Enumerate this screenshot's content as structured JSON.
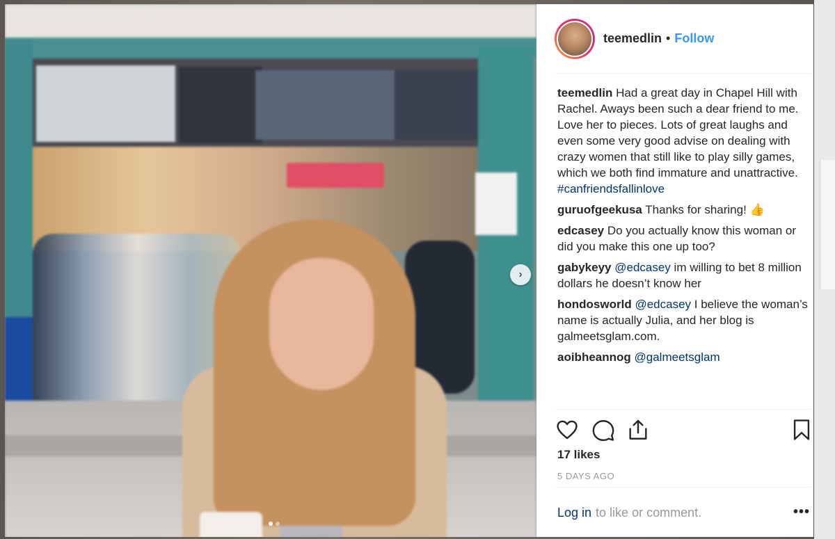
{
  "post": {
    "username": "teemedlin",
    "separator": "•",
    "follow_label": "Follow",
    "caption": {
      "author": "teemedlin",
      "text": "Had a great day in Chapel Hill with Rachel. Aways been such a dear friend to me. Love her to pieces. Lots of great laughs and even some very good advise on dealing with crazy women that still like to play silly games, which we both find immature and unattractive.",
      "hashtag": "#canfriendsfallinlove"
    },
    "comments": [
      {
        "author": "guruofgeekusa",
        "mention": "",
        "text": "Thanks for sharing! 👍"
      },
      {
        "author": "edcasey",
        "mention": "",
        "text": "Do you actually know this woman or did you make this one up too?"
      },
      {
        "author": "gabykeyy",
        "mention": "@edcasey",
        "text": "im willing to bet 8 million dollars he doesn’t know her"
      },
      {
        "author": "hondosworld",
        "mention": "@edcasey",
        "text": "I believe the woman’s name is actually Julia, and her blog is galmeetsglam.com."
      },
      {
        "author": "aoibheannog",
        "mention": "@galmeetsglam",
        "text": ""
      }
    ],
    "likes_label": "17 likes",
    "timestamp": "5 DAYS AGO",
    "login_link": "Log in",
    "login_rest": "to like or comment.",
    "more_label": "•••",
    "carousel": {
      "next_glyph": "›",
      "slides": 2,
      "current": 1
    },
    "icons": [
      "heart-icon",
      "comment-icon",
      "share-icon",
      "bookmark-icon"
    ],
    "colors": {
      "link": "#3897f0",
      "mention": "#003569",
      "text": "#262626",
      "muted": "#999999"
    }
  }
}
